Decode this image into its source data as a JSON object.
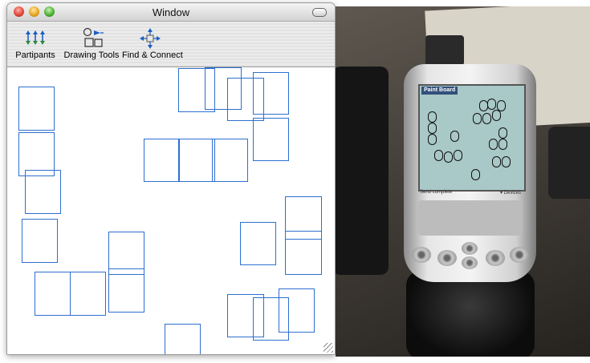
{
  "window": {
    "title": "Window"
  },
  "toolbar": {
    "items": [
      {
        "label": "Partipants",
        "icon": "participants-icon"
      },
      {
        "label": "Drawing Tools",
        "icon": "drawing-tools-icon"
      },
      {
        "label": "Find & Connect",
        "icon": "find-connect-icon"
      }
    ]
  },
  "canvas": {
    "card_color": "#2e6fd0"
  },
  "device_photo": {
    "screen_title": "Paint Board",
    "status_left": "Send complete",
    "status_right": "▾ Devices"
  }
}
